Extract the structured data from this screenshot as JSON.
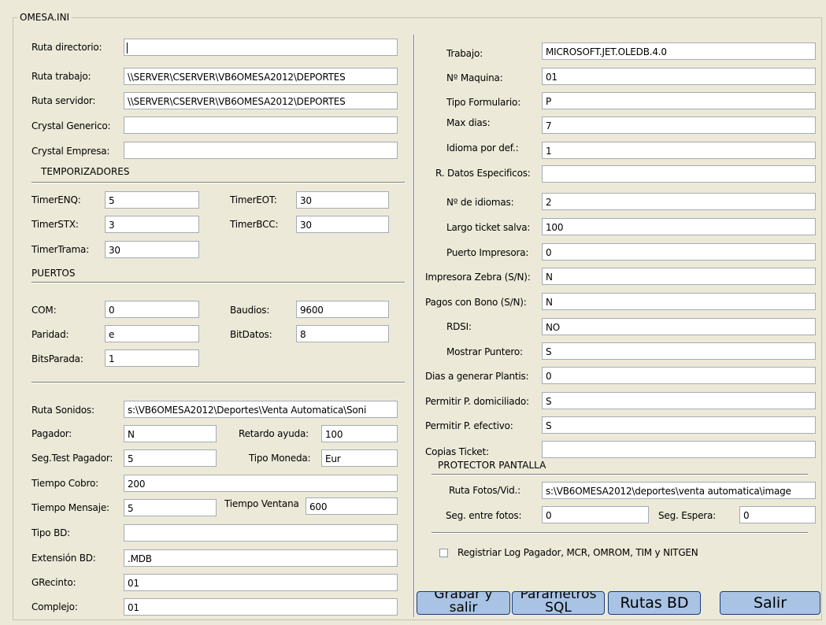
{
  "window": {
    "frame_title": "OMESA.INI"
  },
  "left": {
    "rutas": [
      {
        "label": "Ruta directorio:",
        "value": "",
        "focused": true
      },
      {
        "label": "Ruta trabajo:",
        "value": "\\\\SERVER\\CSERVER\\VB6OMESA2012\\DEPORTES"
      },
      {
        "label": "Ruta servidor:",
        "value": "\\\\SERVER\\CSERVER\\VB6OMESA2012\\DEPORTES"
      },
      {
        "label": "Crystal Generico:",
        "value": ""
      },
      {
        "label": "Crystal Empresa:",
        "value": ""
      }
    ],
    "temporizadores": {
      "title": "TEMPORIZADORES",
      "timer_enq": {
        "label": "TimerENQ:",
        "value": "5"
      },
      "timer_eot": {
        "label": "TimerEOT:",
        "value": "30"
      },
      "timer_stx": {
        "label": "TimerSTX:",
        "value": "3"
      },
      "timer_bcc": {
        "label": "TimerBCC:",
        "value": "30"
      },
      "timer_trama": {
        "label": "TimerTrama:",
        "value": "30"
      }
    },
    "puertos": {
      "title": "PUERTOS",
      "com": {
        "label": "COM:",
        "value": "0"
      },
      "baudios": {
        "label": "Baudios:",
        "value": "9600"
      },
      "paridad": {
        "label": "Paridad:",
        "value": "e"
      },
      "bitdatos": {
        "label": "BitDatos:",
        "value": "8"
      },
      "bitsparada": {
        "label": "BitsParada:",
        "value": "1"
      }
    },
    "otros": {
      "ruta_sonidos": {
        "label": "Ruta Sonidos:",
        "value": "s:\\VB6OMESA2012\\Deportes\\Venta Automatica\\Soni"
      },
      "pagador": {
        "label": "Pagador:",
        "value": "N"
      },
      "retardo_ayuda": {
        "label": "Retardo ayuda:",
        "value": "100"
      },
      "seg_test_pagador": {
        "label": "Seg.Test Pagador:",
        "value": "5"
      },
      "tipo_moneda": {
        "label": "Tipo Moneda:",
        "value": "Eur"
      },
      "tiempo_cobro": {
        "label": "Tiempo Cobro:",
        "value": "200"
      },
      "tiempo_mensaje": {
        "label": "Tiempo Mensaje:",
        "value": "5"
      },
      "tiempo_ventana": {
        "label": "Tiempo Ventana",
        "value": "600"
      },
      "tipo_bd": {
        "label": "Tipo BD:",
        "value": ""
      },
      "extension_bd": {
        "label": "Extensión BD:",
        "value": ".MDB"
      },
      "grecinto": {
        "label": "GRecinto:",
        "value": "01"
      },
      "complejo": {
        "label": "Complejo:",
        "value": "01"
      }
    }
  },
  "right": {
    "fields": [
      {
        "label": "Trabajo:",
        "value": "MICROSOFT.JET.OLEDB.4.0"
      },
      {
        "label": "Nº Maquina:",
        "value": "01"
      },
      {
        "label": "Tipo Formulario:",
        "value": "P"
      },
      {
        "label": "Max dias:",
        "value": "7"
      },
      {
        "label": "Idioma por def.:",
        "value": "1"
      },
      {
        "label": "R. Datos Especificos:",
        "value": ""
      },
      {
        "label": "Nº de idiomas:",
        "value": "2"
      },
      {
        "label": "Largo ticket salva:",
        "value": "100"
      },
      {
        "label": "Puerto Impresora:",
        "value": "0"
      },
      {
        "label": "Impresora Zebra (S/N):",
        "value": "N"
      },
      {
        "label": "Pagos con Bono (S/N):",
        "value": "N"
      },
      {
        "label": "RDSI:",
        "value": "NO"
      },
      {
        "label": "Mostrar Puntero:",
        "value": "S"
      },
      {
        "label": "Dias a generar Plantis:",
        "value": "0"
      },
      {
        "label": "Permitir P. domiciliado:",
        "value": "S"
      },
      {
        "label": "Permitir P. efectivo:",
        "value": "S"
      },
      {
        "label": "Copias Ticket:",
        "value": ""
      }
    ],
    "protector": {
      "title": "PROTECTOR PANTALLA",
      "ruta_fotos": {
        "label": "Ruta Fotos/Vid.:",
        "value": "s:\\VB6OMESA2012\\deportes\\venta automatica\\image"
      },
      "seg_entre_fotos": {
        "label": "Seg. entre fotos:",
        "value": "0"
      },
      "seg_espera": {
        "label": "Seg. Espera:",
        "value": "0"
      }
    },
    "log_checkbox": {
      "label": "Registriar Log Pagador, MCR, OMROM, TIM y NITGEN",
      "checked": false
    }
  },
  "buttons": {
    "grabar": {
      "line1": "Grabar y",
      "line2": "salir"
    },
    "parametros": {
      "line1": "Parametros",
      "line2": "SQL"
    },
    "rutas_bd": {
      "label": "Rutas BD"
    },
    "salir": {
      "label": "Salir"
    }
  },
  "colors": {
    "window_bg": "#ece9d8",
    "button_bg": "#a9c3e4",
    "button_border": "#1c3c78",
    "field_border": "#a5acb5"
  }
}
